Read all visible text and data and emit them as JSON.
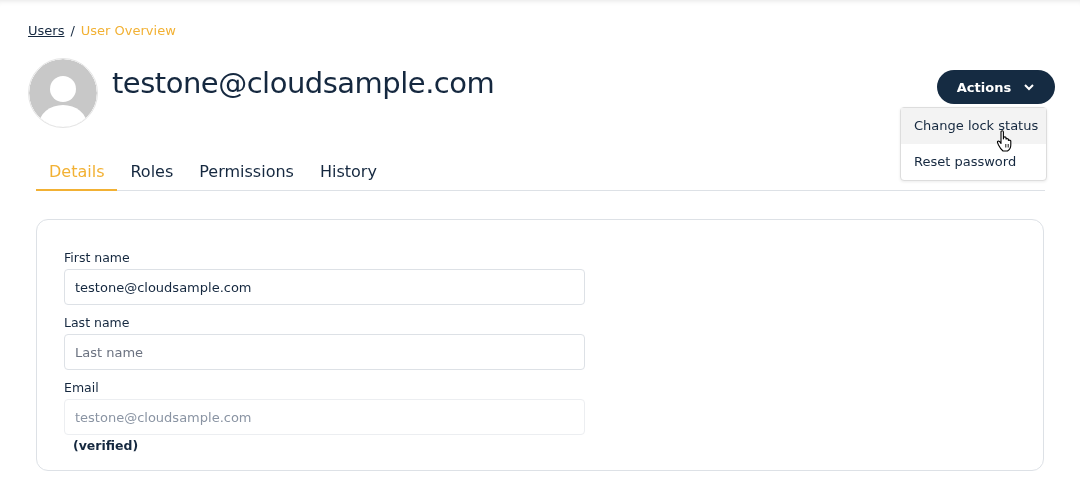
{
  "breadcrumb": [
    {
      "label": "Users",
      "current": false
    },
    {
      "label": "User Overview",
      "current": true
    }
  ],
  "breadcrumb_separator": "/",
  "user": {
    "title": "testone@cloudsample.com"
  },
  "actions": {
    "label": "Actions",
    "expanded": true,
    "menu": [
      {
        "label": "Change lock status",
        "highlighted": true
      },
      {
        "label": "Reset password",
        "highlighted": false
      }
    ]
  },
  "tabs": [
    {
      "label": "Details",
      "selected": true
    },
    {
      "label": "Roles",
      "selected": false
    },
    {
      "label": "Permissions",
      "selected": false
    },
    {
      "label": "History",
      "selected": false
    }
  ],
  "form": [
    {
      "label": "First name",
      "value": "testone@cloudsample.com",
      "disabled": false
    },
    {
      "label": "Last name",
      "placeholder": "Last name",
      "disabled": false
    },
    {
      "label": "Email",
      "value": "testone@cloudsample.com",
      "disabled": true,
      "note": "(verified)"
    }
  ]
}
